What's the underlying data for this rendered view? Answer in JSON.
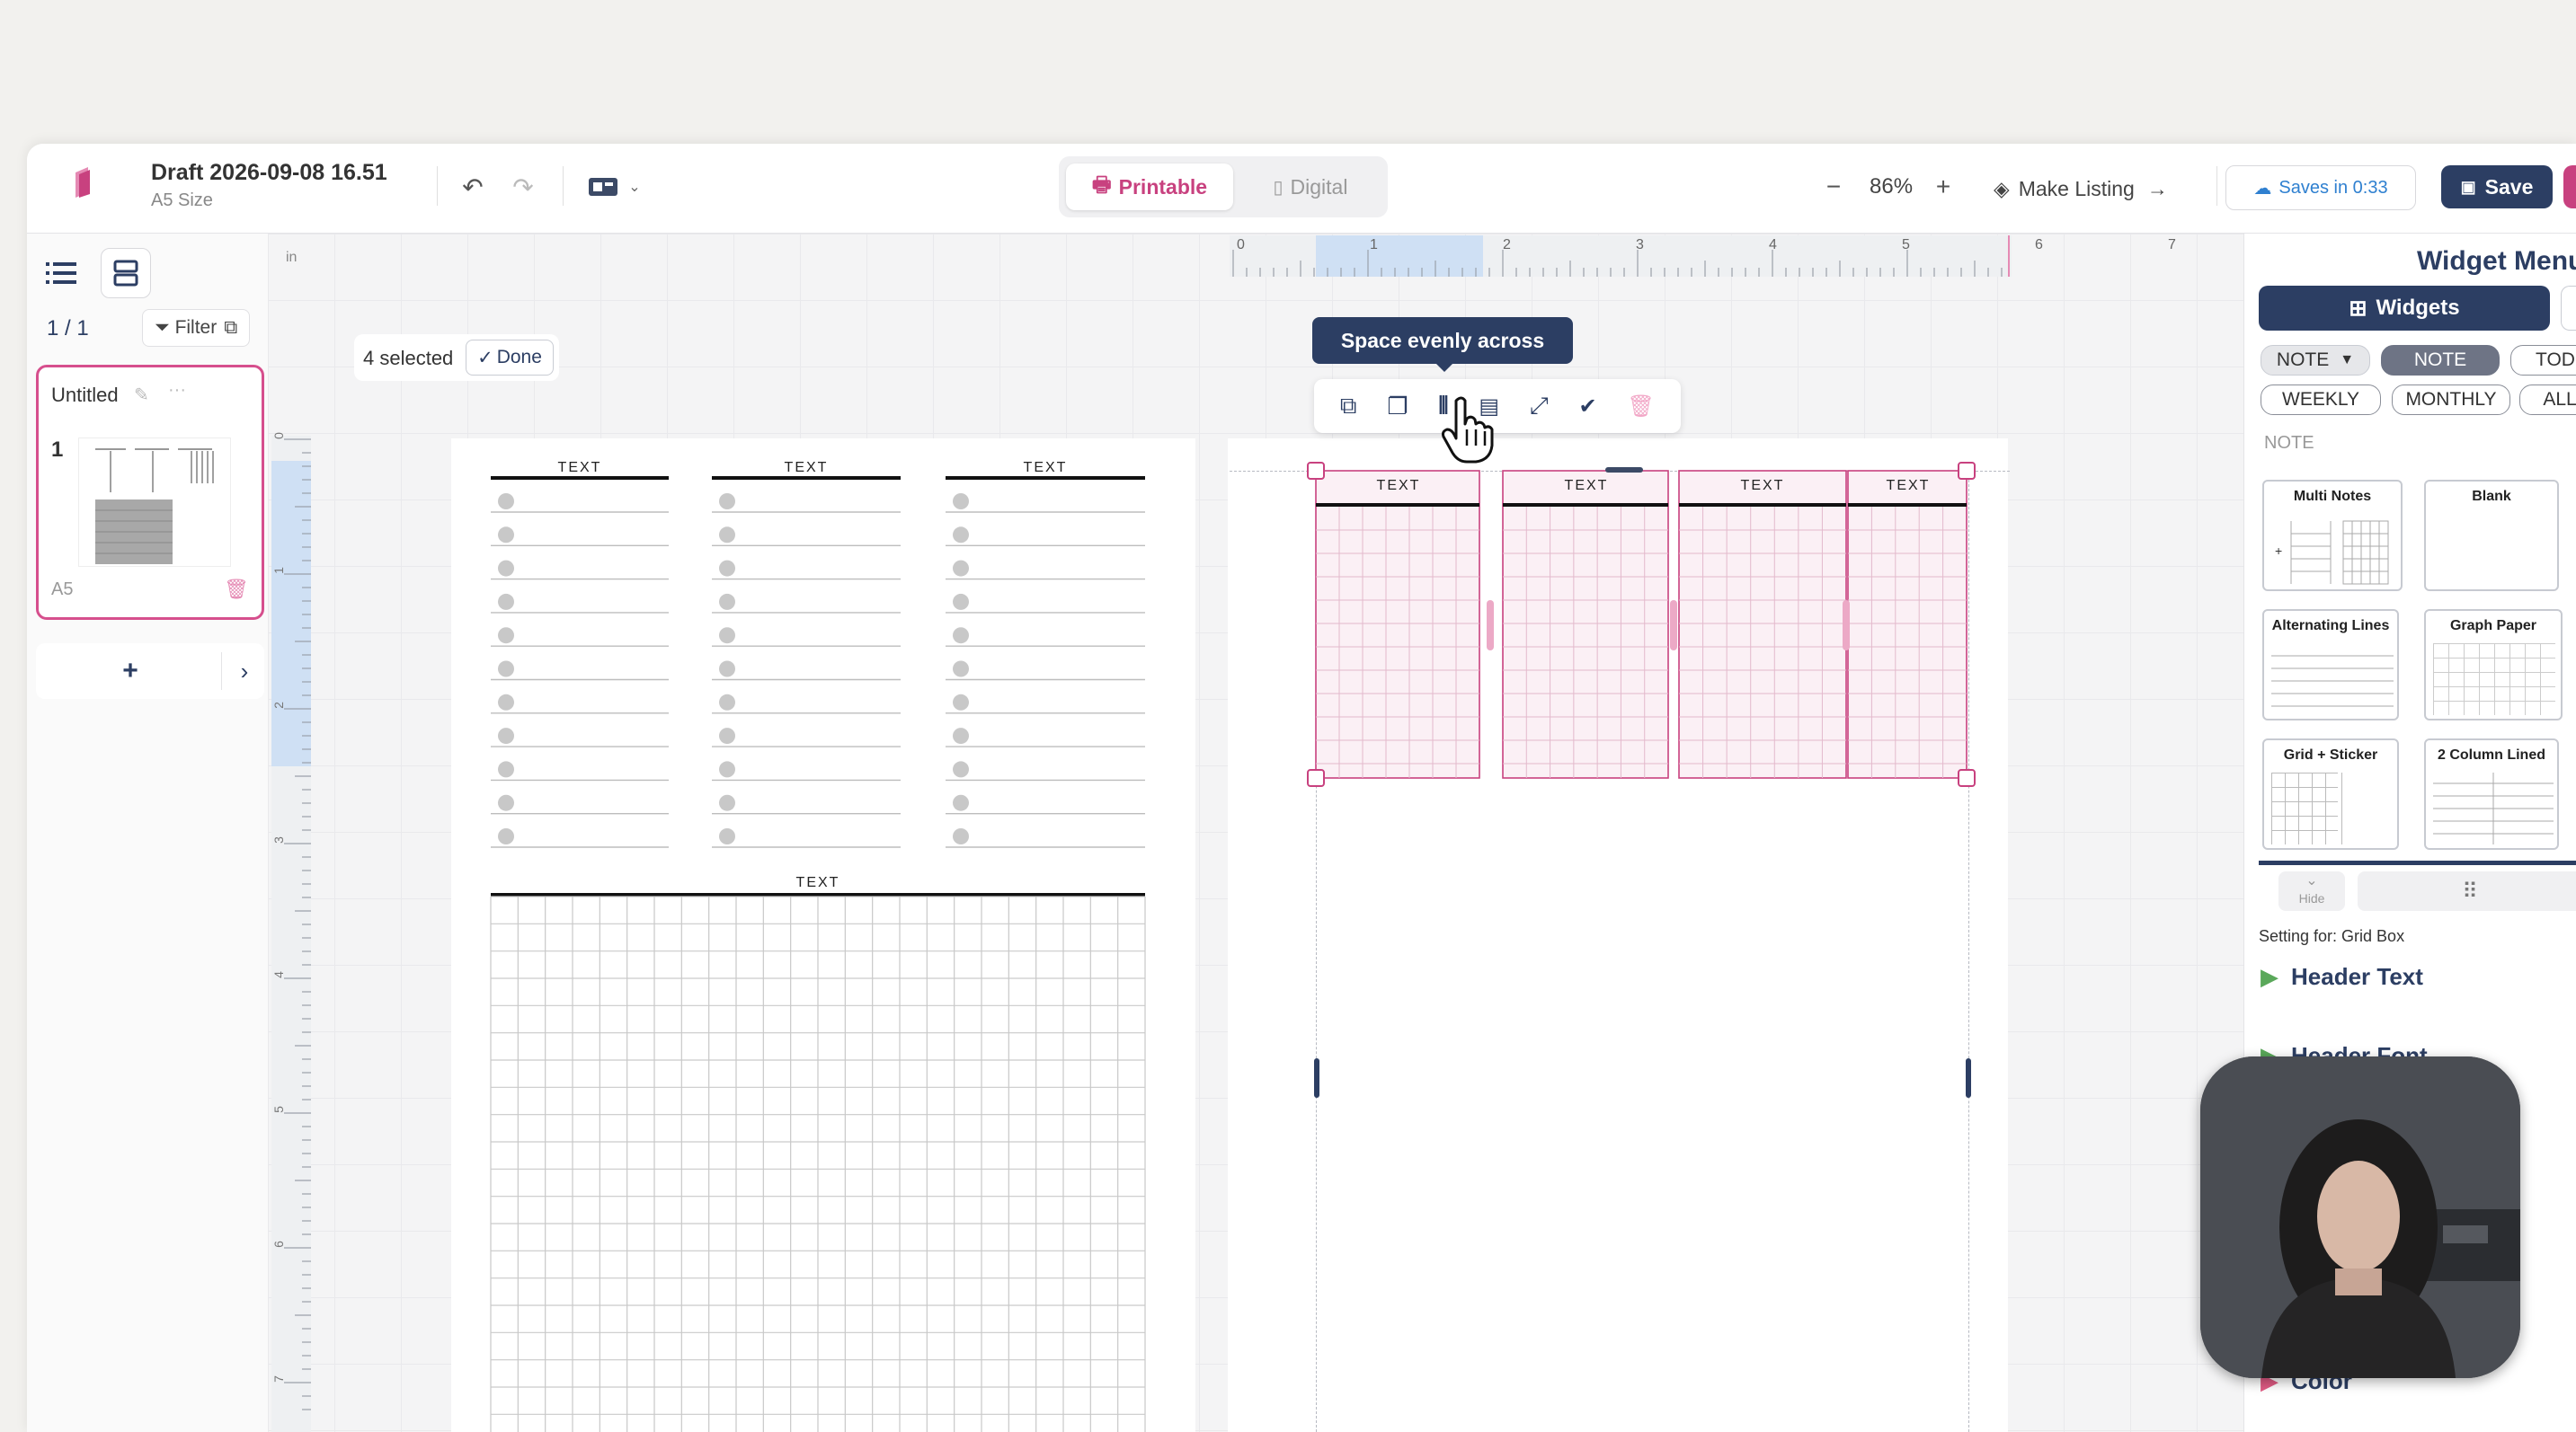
{
  "header": {
    "title": "Draft 2026-09-08 16.51",
    "subtitle": "A5 Size",
    "mode_tabs": [
      "Printable",
      "Digital"
    ],
    "zoom": "86%",
    "make_listing": "Make Listing",
    "saves_in": "Saves in 0:33",
    "save": "Save"
  },
  "sidebar": {
    "page_count": "1 / 1",
    "filter": "Filter",
    "page": {
      "name": "Untitled",
      "number": "1",
      "size": "A5"
    },
    "add": "+"
  },
  "canvas": {
    "selection": {
      "count": "4 selected",
      "done": "Done"
    },
    "tooltip": "Space evenly across",
    "ruler_unit": "in",
    "top_ruler": [
      "0",
      "1",
      "2",
      "3",
      "4",
      "5",
      "6",
      "7"
    ],
    "left_ruler": [
      "0",
      "1",
      "2",
      "3",
      "4",
      "5",
      "6",
      "7"
    ],
    "left_page": {
      "column_headers": [
        "TEXT",
        "TEXT",
        "TEXT"
      ],
      "grid_header": "TEXT"
    },
    "right_page": {
      "column_headers": [
        "TEXT",
        "TEXT",
        "TEXT",
        "TEXT"
      ]
    }
  },
  "widget_menu": {
    "title": "Widget Menu",
    "widgets_tab": "Widgets",
    "filters": [
      "NOTE",
      "NOTE",
      "TOD",
      "WEEKLY",
      "MONTHLY",
      "ALL"
    ],
    "section": "NOTE",
    "templates": [
      "Multi Notes",
      "Blank",
      "Alternating Lines",
      "Graph Paper",
      "Grid + Sticker",
      "2 Column Lined"
    ],
    "hide": "Hide",
    "setting_for": "Setting for: Grid Box",
    "header_text": "Header Text",
    "header_font": "Header Font",
    "color": "Color"
  },
  "colors": {
    "accent": "#c8417f",
    "navy": "#2c3e63",
    "pink_fill": "#fbf0f5"
  }
}
